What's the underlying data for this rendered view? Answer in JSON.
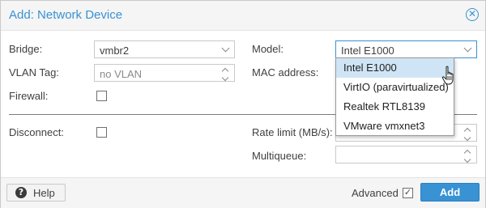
{
  "dialog": {
    "title": "Add: Network Device"
  },
  "form": {
    "bridge_label": "Bridge:",
    "bridge_value": "vmbr2",
    "vlan_label": "VLAN Tag:",
    "vlan_placeholder": "no VLAN",
    "firewall_label": "Firewall:",
    "firewall_checked": false,
    "model_label": "Model:",
    "model_value": "Intel E1000",
    "mac_label": "MAC address:",
    "disconnect_label": "Disconnect:",
    "disconnect_checked": false,
    "rate_label": "Rate limit (MB/s):",
    "multiqueue_label": "Multiqueue:"
  },
  "model_dropdown": {
    "options": [
      "Intel E1000",
      "VirtIO (paravirtualized)",
      "Realtek RTL8139",
      "VMware vmxnet3"
    ],
    "selected_index": 0
  },
  "footer": {
    "help_label": "Help",
    "advanced_label": "Advanced",
    "advanced_checked": true,
    "add_label": "Add"
  },
  "colors": {
    "accent": "#3892d4",
    "selected_row": "#cfe5f5"
  }
}
